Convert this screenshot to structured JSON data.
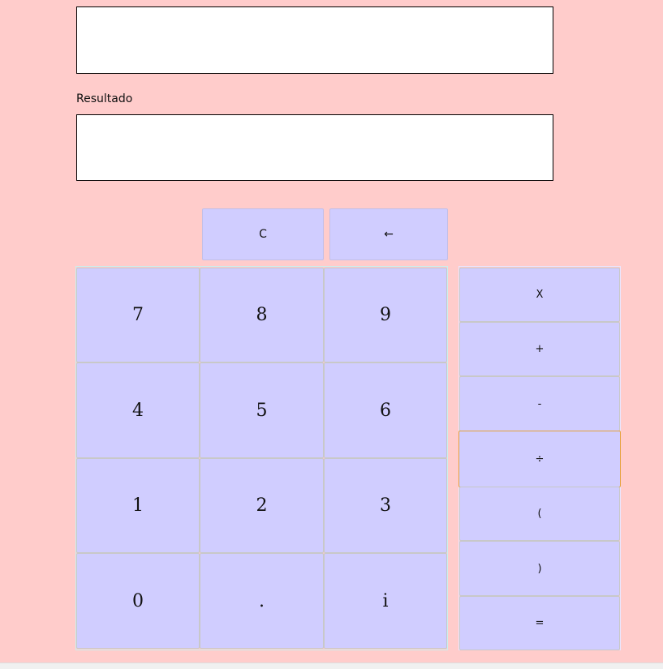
{
  "expression": {
    "value": "",
    "placeholder": ""
  },
  "result": {
    "label": "Resultado",
    "value": "",
    "placeholder": ""
  },
  "controls": {
    "clear": "C",
    "backspace": "←"
  },
  "keypad": {
    "row1": [
      "7",
      "8",
      "9"
    ],
    "row2": [
      "4",
      "5",
      "6"
    ],
    "row3": [
      "1",
      "2",
      "3"
    ],
    "row4": [
      "0",
      ".",
      "i"
    ]
  },
  "operators": [
    "X",
    "+",
    "-",
    "÷",
    "(",
    ")",
    "="
  ],
  "colors": {
    "background": "#ffcccb",
    "button": "#d0cdff",
    "focus_border": "#e6a23c"
  }
}
